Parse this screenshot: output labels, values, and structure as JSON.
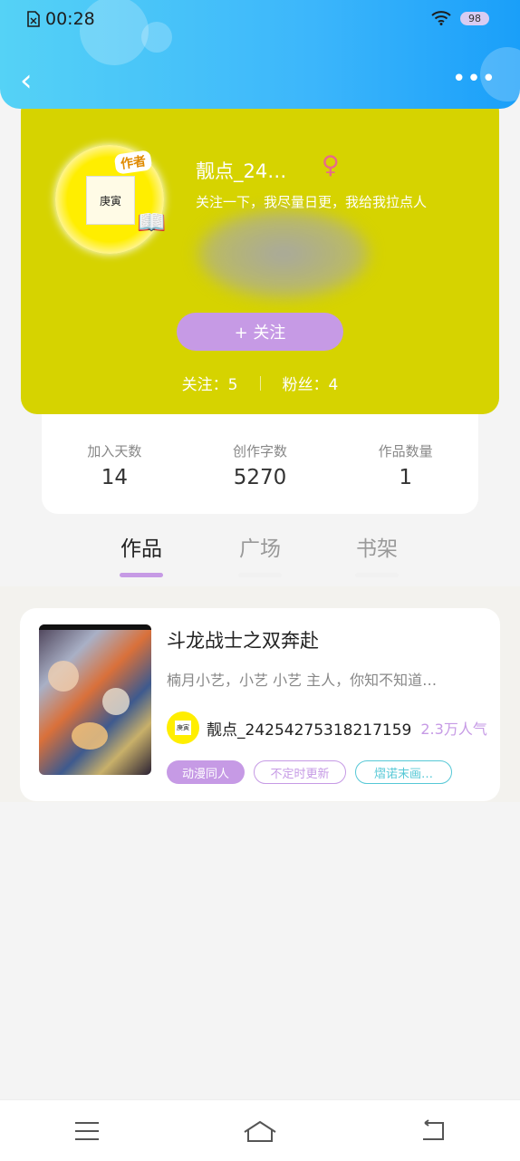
{
  "status_bar": {
    "time": "00:28",
    "battery": "98"
  },
  "header": {
    "back_icon": "back-arrow-icon",
    "more_icon": "more-icon",
    "more_glyph": "•••",
    "back_glyph": "‹"
  },
  "profile": {
    "badge": "作者",
    "avatar_text": "庚寅",
    "name": "靓点_24…",
    "gender_symbol": "♀",
    "bio": "关注一下，我尽量日更，我给我拉点人",
    "follow_button": "+  关注",
    "following_label": "关注：5",
    "fans_label": "粉丝：4",
    "background_color": "#d6d300"
  },
  "stats": [
    {
      "label": "加入天数",
      "value": "14"
    },
    {
      "label": "创作字数",
      "value": "5270"
    },
    {
      "label": "作品数量",
      "value": "1"
    }
  ],
  "tabs": [
    {
      "label": "作品",
      "active": true
    },
    {
      "label": "广场",
      "active": false
    },
    {
      "label": "书架",
      "active": false
    }
  ],
  "works": [
    {
      "title": "斗龙战士之双奔赴",
      "description": "楠月小艺，小艺 小艺 主人，你知不知道…",
      "author_avatar_text": "庚寅",
      "author": "靓点_24254275318217159",
      "popularity": "2.3万人气",
      "tags": [
        "动漫同人",
        "不定时更新",
        "熠诺末画…"
      ]
    }
  ],
  "colors": {
    "accent_purple": "#c69ae5",
    "tag_teal": "#56c8d6",
    "header_blue": "#3cb6fb"
  },
  "nav": {
    "menu_icon": "menu-icon",
    "home_icon": "home-icon",
    "back_icon": "return-icon"
  }
}
